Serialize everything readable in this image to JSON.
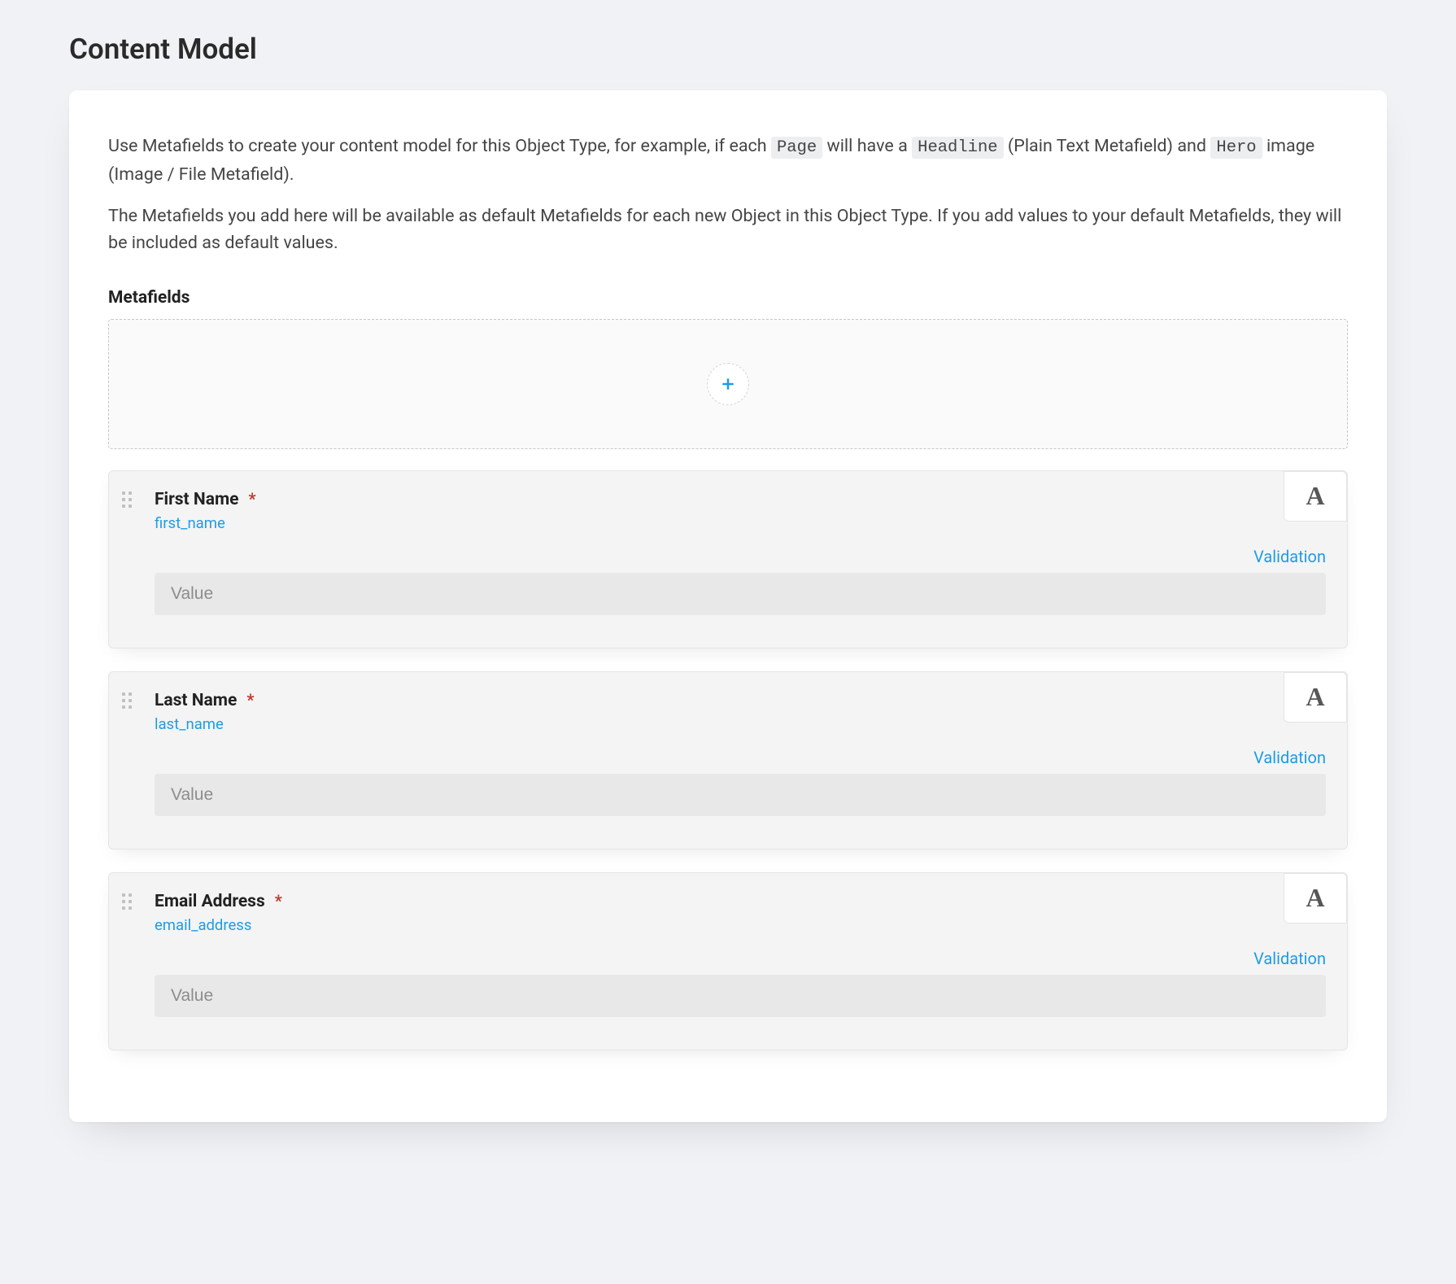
{
  "page_title": "Content Model",
  "intro": {
    "p1_part1": "Use Metafields to create your content model for this Object Type, for example, if each ",
    "code1": "Page",
    "p1_part2": " will have a ",
    "code2": "Headline",
    "p1_part3": " (Plain Text Metafield) and ",
    "code3": "Hero",
    "p1_part4": " image (Image / File Metafield).",
    "p2": "The Metafields you add here will be available as default Metafields for each new Object in this Object Type. If you add values to your default Metafields, they will be included as default values."
  },
  "section_label": "Metafields",
  "validation_label": "Validation",
  "value_placeholder": "Value",
  "type_glyph": "A",
  "required_star": "*",
  "fields": [
    {
      "label": "First Name",
      "key": "first_name",
      "required": true
    },
    {
      "label": "Last Name",
      "key": "last_name",
      "required": true
    },
    {
      "label": "Email Address",
      "key": "email_address",
      "required": true
    }
  ]
}
